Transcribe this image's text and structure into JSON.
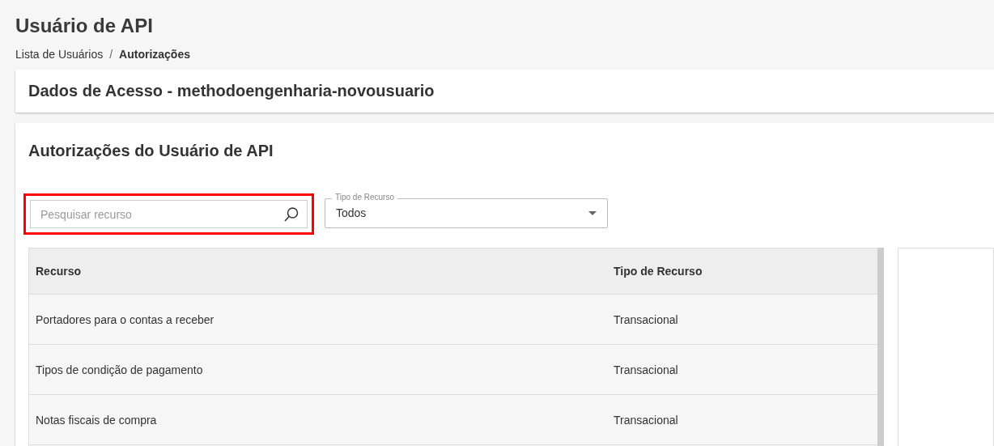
{
  "page_title": "Usuário de API",
  "breadcrumb": [
    {
      "label": "Lista de Usuários",
      "current": false
    },
    {
      "label": "Autorizações",
      "current": true
    }
  ],
  "breadcrumb_separator": "/",
  "access_card": {
    "title": "Dados de Acesso - methodoengenharia-novousuario"
  },
  "authorizations": {
    "title": "Autorizações do Usuário de API",
    "search": {
      "placeholder": "Pesquisar recurso",
      "highlighted": true
    },
    "type_select": {
      "label": "Tipo de Recurso",
      "value": "Todos"
    },
    "table": {
      "columns": [
        "Recurso",
        "Tipo de Recurso"
      ],
      "rows": [
        {
          "cells": [
            "Portadores para o contas a receber",
            "Transacional"
          ]
        },
        {
          "cells": [
            "Tipos de condição de pagamento",
            "Transacional"
          ]
        },
        {
          "cells": [
            "Notas fiscais de compra",
            "Transacional"
          ]
        }
      ]
    }
  }
}
